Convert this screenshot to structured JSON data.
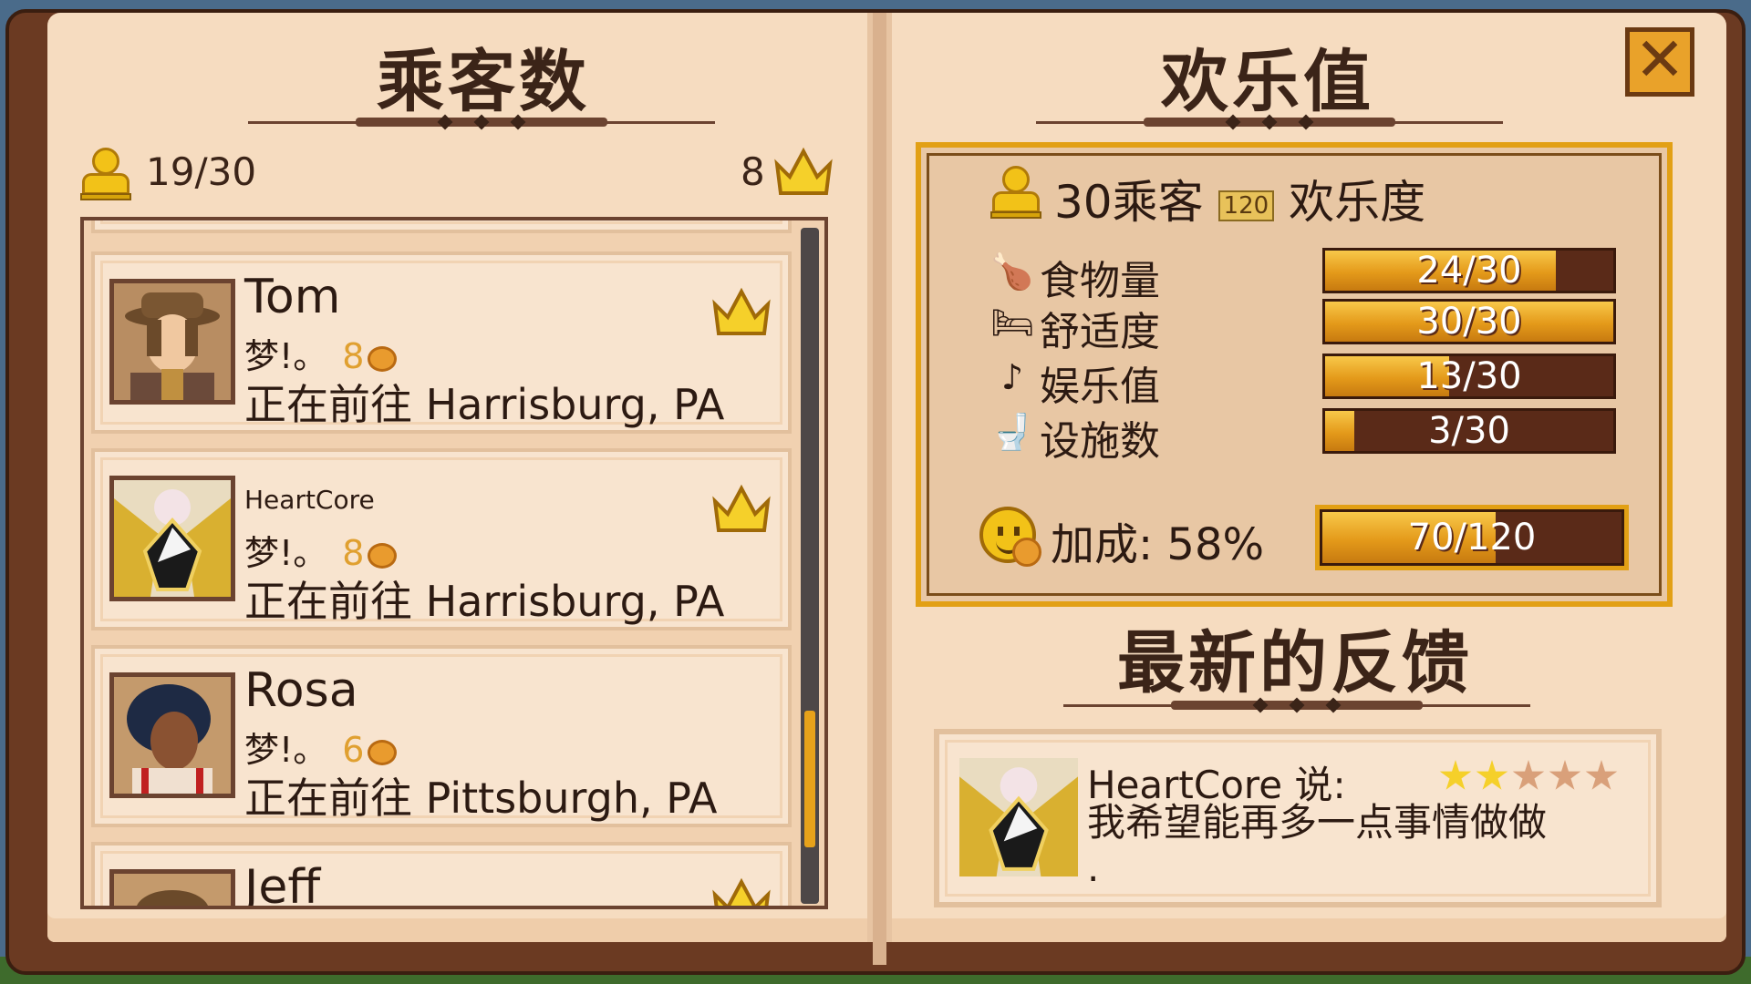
{
  "left_page": {
    "title": "乘客数",
    "passenger_count": "19/30",
    "vip_count": "8"
  },
  "passengers": [
    {
      "name": "Tom",
      "mood_label": "梦!。",
      "mood_value": "8",
      "dest_label": "正在前往",
      "destination": "Harrisburg, PA",
      "vip": true
    },
    {
      "name": "HeartCore",
      "mood_label": "梦!。",
      "mood_value": "8",
      "dest_label": "正在前往",
      "destination": "Harrisburg, PA",
      "vip": true
    },
    {
      "name": "Rosa",
      "mood_label": "梦!。",
      "mood_value": "6",
      "dest_label": "正在前往",
      "destination": "Pittsburgh, PA",
      "vip": false
    },
    {
      "name": "Jeff",
      "vip": true
    }
  ],
  "right_page": {
    "title": "欢乐值",
    "summary_count": "30乘客",
    "summary_badge": "120",
    "summary_label": "欢乐度",
    "stats": [
      {
        "icon": "drumstick-icon",
        "label": "食物量",
        "value": "24/30",
        "fraction": 0.8
      },
      {
        "icon": "bed-icon",
        "label": "舒适度",
        "value": "30/30",
        "fraction": 1.0
      },
      {
        "icon": "music-note-icon",
        "label": "娱乐值",
        "value": "13/30",
        "fraction": 0.43
      },
      {
        "icon": "toilet-icon",
        "label": "设施数",
        "value": "3/30",
        "fraction": 0.1
      }
    ],
    "bonus_label": "加成: 58%",
    "total_value": "70/120",
    "total_fraction": 0.58,
    "feedback_title": "最新的反馈",
    "feedback": {
      "author": "HeartCore 说:",
      "text": "我希望能再多一点事情做做",
      "text2": ".",
      "stars_on": 2,
      "stars_total": 5
    }
  },
  "close_label": "✕",
  "colors": {
    "gold": "#f2c218",
    "bar_fill": "#e49a1a",
    "page": "#f6dcc0",
    "cover": "#6b3a22"
  }
}
